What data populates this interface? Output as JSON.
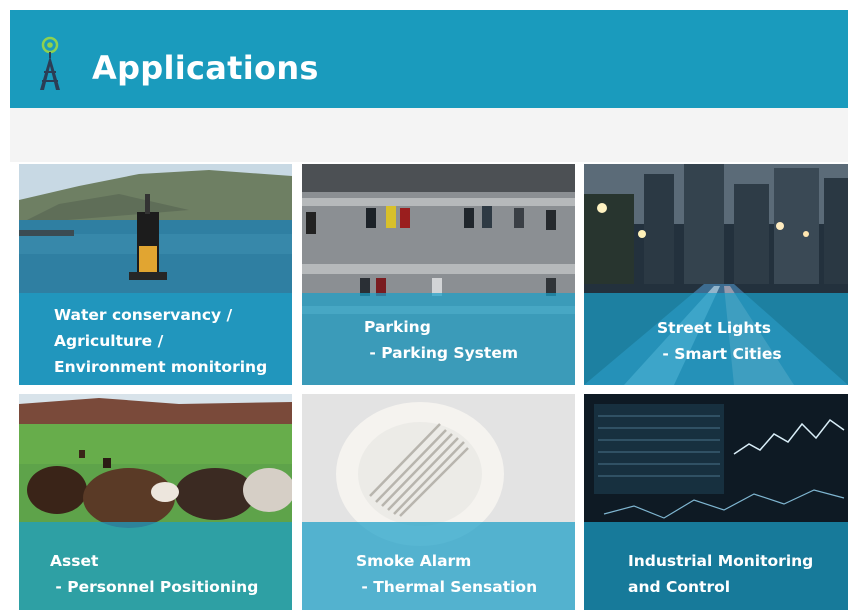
{
  "header": {
    "title": "Applications",
    "icon": "radio-tower-icon",
    "background": "#1a9bbd"
  },
  "overlay_color": "#1ca0c8",
  "tiles": [
    {
      "id": "water",
      "caption": "Water conservancy /\nAgriculture /\nEnvironment monitoring"
    },
    {
      "id": "parking",
      "caption": "Parking\n - Parking System"
    },
    {
      "id": "street",
      "caption": "Street Lights\n - Smart Cities"
    },
    {
      "id": "asset",
      "caption": "Asset\n - Personnel Positioning"
    },
    {
      "id": "smoke",
      "caption": "Smoke Alarm\n - Thermal Sensation"
    },
    {
      "id": "industrial",
      "caption": "Industrial Monitoring\nand Control"
    }
  ]
}
